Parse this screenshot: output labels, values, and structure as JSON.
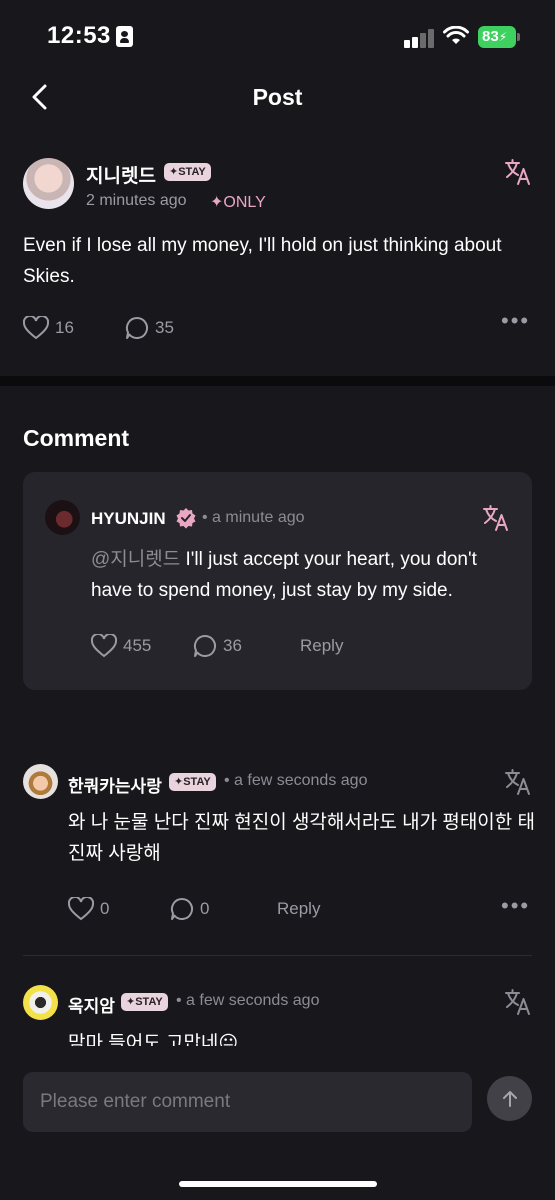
{
  "status_bar": {
    "time": "12:53",
    "battery": "83",
    "icons": [
      "id-card-icon",
      "cellular-signal-icon",
      "wifi-icon",
      "battery-charging-icon"
    ]
  },
  "header": {
    "title": "Post",
    "back_icon": "chevron-left-icon"
  },
  "post": {
    "author": "지니렛드",
    "badge": "✦STAY",
    "time": "2 minutes ago",
    "only": "✦ONLY",
    "text": "Even if I lose all my money, I'll hold on just thinking about Skies.",
    "likes": "16",
    "comments": "35"
  },
  "comments": {
    "heading": "Comment",
    "artist_comment": {
      "author": "HYUNJIN",
      "verified_icon": "verified-badge-icon",
      "time": "• a minute ago",
      "mention": "@지니렛드",
      "text": " I'll just accept your heart, you don't have to spend money, just stay by my side.",
      "likes": "455",
      "replies": "36",
      "reply_label": "Reply"
    },
    "items": [
      {
        "author": "한쿼카는사랑",
        "badge": "✦STAY",
        "time": "• a few seconds ago",
        "text": "와 나 눈물 난다 진짜 현진이 생각해서라도 내가 평태이한 태 진짜 사랑해",
        "likes": "0",
        "replies": "0",
        "reply_label": "Reply"
      },
      {
        "author": "옥지암",
        "badge": "✦STAY",
        "time": "• a few seconds ago",
        "text": "맘마 들어도 고맙네😐"
      }
    ]
  },
  "composer": {
    "placeholder": "Please enter comment",
    "send_icon": "arrow-up-icon"
  },
  "colors": {
    "background": "#18171c",
    "card": "#26252b",
    "accent_pink": "#e9a7c4",
    "muted_text": "#9c9aa3"
  }
}
